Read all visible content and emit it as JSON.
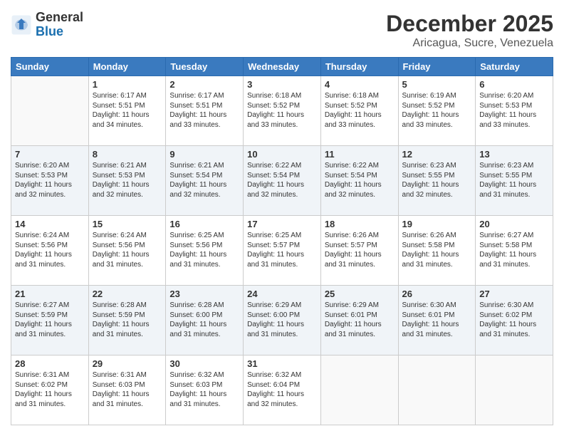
{
  "header": {
    "logo_general": "General",
    "logo_blue": "Blue",
    "month": "December 2025",
    "location": "Aricagua, Sucre, Venezuela"
  },
  "days_of_week": [
    "Sunday",
    "Monday",
    "Tuesday",
    "Wednesday",
    "Thursday",
    "Friday",
    "Saturday"
  ],
  "weeks": [
    [
      {
        "day": "",
        "info": ""
      },
      {
        "day": "1",
        "info": "Sunrise: 6:17 AM\nSunset: 5:51 PM\nDaylight: 11 hours\nand 34 minutes."
      },
      {
        "day": "2",
        "info": "Sunrise: 6:17 AM\nSunset: 5:51 PM\nDaylight: 11 hours\nand 33 minutes."
      },
      {
        "day": "3",
        "info": "Sunrise: 6:18 AM\nSunset: 5:52 PM\nDaylight: 11 hours\nand 33 minutes."
      },
      {
        "day": "4",
        "info": "Sunrise: 6:18 AM\nSunset: 5:52 PM\nDaylight: 11 hours\nand 33 minutes."
      },
      {
        "day": "5",
        "info": "Sunrise: 6:19 AM\nSunset: 5:52 PM\nDaylight: 11 hours\nand 33 minutes."
      },
      {
        "day": "6",
        "info": "Sunrise: 6:20 AM\nSunset: 5:53 PM\nDaylight: 11 hours\nand 33 minutes."
      }
    ],
    [
      {
        "day": "7",
        "info": "Sunrise: 6:20 AM\nSunset: 5:53 PM\nDaylight: 11 hours\nand 32 minutes."
      },
      {
        "day": "8",
        "info": "Sunrise: 6:21 AM\nSunset: 5:53 PM\nDaylight: 11 hours\nand 32 minutes."
      },
      {
        "day": "9",
        "info": "Sunrise: 6:21 AM\nSunset: 5:54 PM\nDaylight: 11 hours\nand 32 minutes."
      },
      {
        "day": "10",
        "info": "Sunrise: 6:22 AM\nSunset: 5:54 PM\nDaylight: 11 hours\nand 32 minutes."
      },
      {
        "day": "11",
        "info": "Sunrise: 6:22 AM\nSunset: 5:54 PM\nDaylight: 11 hours\nand 32 minutes."
      },
      {
        "day": "12",
        "info": "Sunrise: 6:23 AM\nSunset: 5:55 PM\nDaylight: 11 hours\nand 32 minutes."
      },
      {
        "day": "13",
        "info": "Sunrise: 6:23 AM\nSunset: 5:55 PM\nDaylight: 11 hours\nand 31 minutes."
      }
    ],
    [
      {
        "day": "14",
        "info": "Sunrise: 6:24 AM\nSunset: 5:56 PM\nDaylight: 11 hours\nand 31 minutes."
      },
      {
        "day": "15",
        "info": "Sunrise: 6:24 AM\nSunset: 5:56 PM\nDaylight: 11 hours\nand 31 minutes."
      },
      {
        "day": "16",
        "info": "Sunrise: 6:25 AM\nSunset: 5:56 PM\nDaylight: 11 hours\nand 31 minutes."
      },
      {
        "day": "17",
        "info": "Sunrise: 6:25 AM\nSunset: 5:57 PM\nDaylight: 11 hours\nand 31 minutes."
      },
      {
        "day": "18",
        "info": "Sunrise: 6:26 AM\nSunset: 5:57 PM\nDaylight: 11 hours\nand 31 minutes."
      },
      {
        "day": "19",
        "info": "Sunrise: 6:26 AM\nSunset: 5:58 PM\nDaylight: 11 hours\nand 31 minutes."
      },
      {
        "day": "20",
        "info": "Sunrise: 6:27 AM\nSunset: 5:58 PM\nDaylight: 11 hours\nand 31 minutes."
      }
    ],
    [
      {
        "day": "21",
        "info": "Sunrise: 6:27 AM\nSunset: 5:59 PM\nDaylight: 11 hours\nand 31 minutes."
      },
      {
        "day": "22",
        "info": "Sunrise: 6:28 AM\nSunset: 5:59 PM\nDaylight: 11 hours\nand 31 minutes."
      },
      {
        "day": "23",
        "info": "Sunrise: 6:28 AM\nSunset: 6:00 PM\nDaylight: 11 hours\nand 31 minutes."
      },
      {
        "day": "24",
        "info": "Sunrise: 6:29 AM\nSunset: 6:00 PM\nDaylight: 11 hours\nand 31 minutes."
      },
      {
        "day": "25",
        "info": "Sunrise: 6:29 AM\nSunset: 6:01 PM\nDaylight: 11 hours\nand 31 minutes."
      },
      {
        "day": "26",
        "info": "Sunrise: 6:30 AM\nSunset: 6:01 PM\nDaylight: 11 hours\nand 31 minutes."
      },
      {
        "day": "27",
        "info": "Sunrise: 6:30 AM\nSunset: 6:02 PM\nDaylight: 11 hours\nand 31 minutes."
      }
    ],
    [
      {
        "day": "28",
        "info": "Sunrise: 6:31 AM\nSunset: 6:02 PM\nDaylight: 11 hours\nand 31 minutes."
      },
      {
        "day": "29",
        "info": "Sunrise: 6:31 AM\nSunset: 6:03 PM\nDaylight: 11 hours\nand 31 minutes."
      },
      {
        "day": "30",
        "info": "Sunrise: 6:32 AM\nSunset: 6:03 PM\nDaylight: 11 hours\nand 31 minutes."
      },
      {
        "day": "31",
        "info": "Sunrise: 6:32 AM\nSunset: 6:04 PM\nDaylight: 11 hours\nand 32 minutes."
      },
      {
        "day": "",
        "info": ""
      },
      {
        "day": "",
        "info": ""
      },
      {
        "day": "",
        "info": ""
      }
    ]
  ]
}
